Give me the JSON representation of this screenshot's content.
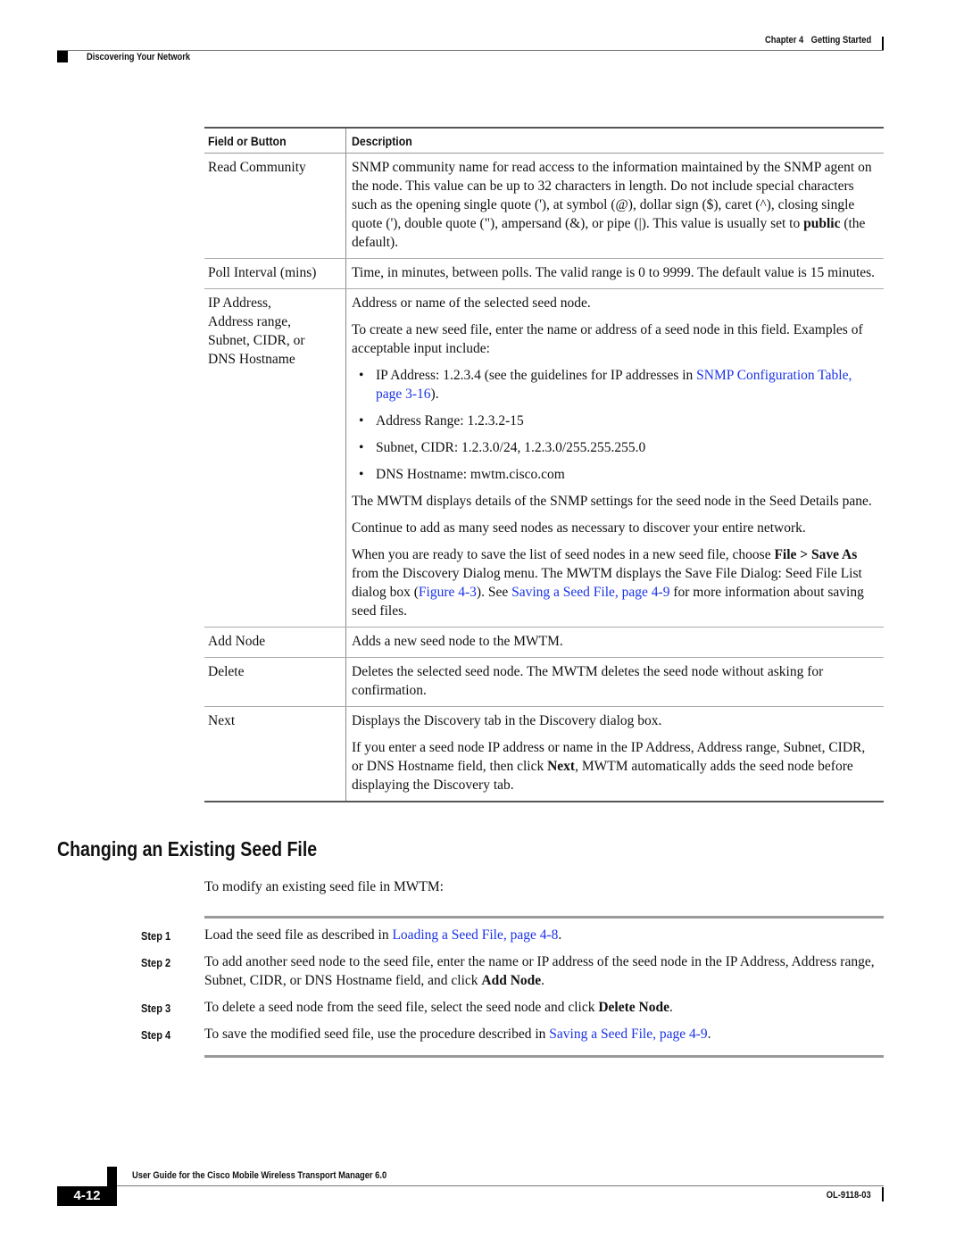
{
  "header": {
    "chapter": "Chapter 4",
    "chapter_title": "Getting Started",
    "section": "Discovering Your Network"
  },
  "table": {
    "headers": [
      "Field or Button",
      "Description"
    ],
    "rows": {
      "read_community": {
        "field": "Read Community",
        "desc_before_bold": "SNMP community name for read access to the information maintained by the SNMP agent on the node. This value can be up to 32 characters in length. Do not include special characters such as the opening single quote ('), at symbol (@), dollar sign ($), caret (^), closing single quote ('), double quote (\"), ampersand (&), or pipe (|). This value is usually set to ",
        "desc_bold": "public",
        "desc_after_bold": " (the default)."
      },
      "poll_interval": {
        "field": "Poll Interval (mins)",
        "desc": "Time, in minutes, between polls. The valid range is 0 to 9999. The default value is 15 minutes."
      },
      "ip_address": {
        "field_lines": [
          "IP Address,",
          "Address range,",
          "Subnet, CIDR, or",
          "DNS Hostname"
        ],
        "p1": "Address or name of the selected seed node.",
        "p2": "To create a new seed file, enter the name or address of a seed node in this field. Examples of acceptable input include:",
        "bullets": {
          "b1_text": "IP Address: 1.2.3.4 (see the guidelines for IP addresses in ",
          "b1_link": "SNMP Configuration Table, page 3-16",
          "b1_end": ").",
          "b2": "Address Range: 1.2.3.2-15",
          "b3": "Subnet, CIDR: 1.2.3.0/24, 1.2.3.0/255.255.255.0",
          "b4": "DNS Hostname: mwtm.cisco.com"
        },
        "p3": "The MWTM displays details of the SNMP settings for the seed node in the Seed Details pane.",
        "p4": "Continue to add as many seed nodes as necessary to discover your entire network.",
        "p5": {
          "t1": "When you are ready to save the list of seed nodes in a new seed file, choose ",
          "b1": "File > Save As",
          "t2": " from the Discovery Dialog menu. The MWTM displays the Save File Dialog: Seed File List dialog box (",
          "link1": "Figure 4-3",
          "t3": "). See ",
          "link2": "Saving a Seed File, page 4-9",
          "t4": " for more information about saving seed files."
        }
      },
      "add_node": {
        "field": "Add Node",
        "desc": "Adds a new seed node to the MWTM."
      },
      "delete": {
        "field": "Delete",
        "desc": "Deletes the selected seed node. The MWTM deletes the seed node without asking for confirmation."
      },
      "next": {
        "field": "Next",
        "p1": "Displays the Discovery tab in the Discovery dialog box.",
        "p2_t1": "If you enter a seed node IP address or name in the IP Address, Address range, Subnet, CIDR, or DNS Hostname field, then click ",
        "p2_bold": "Next",
        "p2_t2": ", MWTM automatically adds the seed node before displaying the Discovery tab."
      }
    }
  },
  "section": {
    "heading": "Changing an Existing Seed File",
    "intro": "To modify an existing seed file in MWTM:",
    "steps": {
      "s1": {
        "label": "Step 1",
        "t1": "Load the seed file as described in ",
        "link": "Loading a Seed File, page 4-8",
        "t2": "."
      },
      "s2": {
        "label": "Step 2",
        "t1": "To add another seed node to the seed file, enter the name or IP address of the seed node in the IP Address, Address range, Subnet, CIDR, or DNS Hostname field, and click ",
        "bold": "Add Node",
        "t2": "."
      },
      "s3": {
        "label": "Step 3",
        "t1": "To delete a seed node from the seed file, select the seed node and click ",
        "bold": "Delete Node",
        "t2": "."
      },
      "s4": {
        "label": "Step 4",
        "t1": "To save the modified seed file, use the procedure described in ",
        "link": "Saving a Seed File, page 4-9",
        "t2": "."
      }
    }
  },
  "footer": {
    "title": "User Guide for the Cisco Mobile Wireless Transport Manager 6.0",
    "page": "4-12",
    "doc_id": "OL-9118-03"
  },
  "colors": {
    "link": "#1a33e6"
  },
  "bullet_glyph": "•"
}
